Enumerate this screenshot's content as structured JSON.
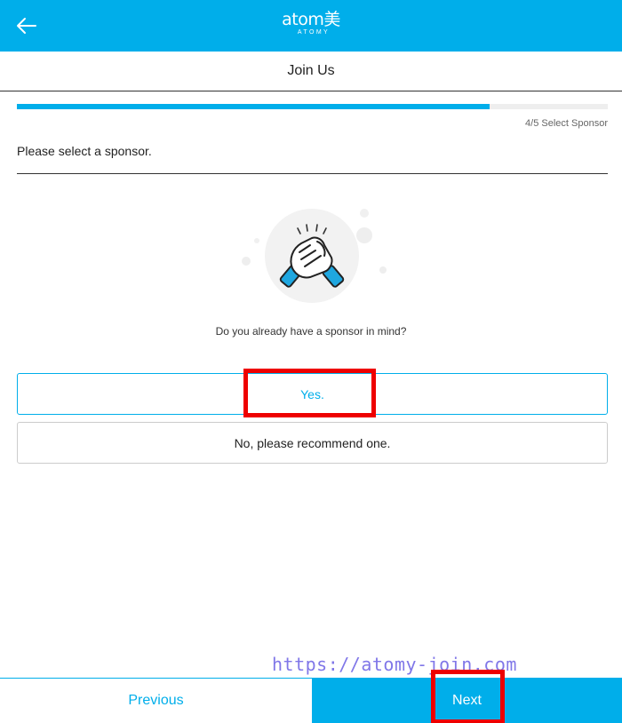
{
  "header": {
    "logo_text": "atom美",
    "logo_subtext": "ATOMY",
    "back_icon": "arrow-left-icon"
  },
  "page": {
    "title": "Join Us"
  },
  "progress": {
    "current_step": 4,
    "total_steps": 5,
    "fraction": 0.8,
    "step_label": "4/5 Select Sponsor"
  },
  "section": {
    "title": "Please select a sponsor."
  },
  "illustration": {
    "icon": "handshake-icon"
  },
  "question": "Do you already have a sponsor in mind?",
  "options": {
    "yes_label": "Yes.",
    "no_label": "No, please recommend one."
  },
  "watermark": "https://atomy-join.com",
  "footer": {
    "previous_label": "Previous",
    "next_label": "Next"
  },
  "colors": {
    "brand": "#00aeea",
    "highlight": "#ee0000",
    "watermark": "#8077e8"
  }
}
